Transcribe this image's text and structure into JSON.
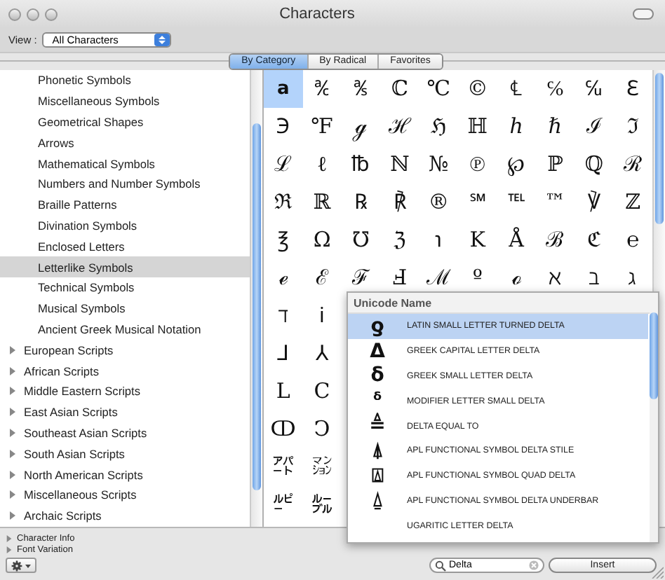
{
  "window": {
    "title": "Characters"
  },
  "toolbar": {
    "view_label": "View :",
    "view_value": "All Characters"
  },
  "tabs": [
    {
      "label": "By Category",
      "selected": true
    },
    {
      "label": "By Radical",
      "selected": false
    },
    {
      "label": "Favorites",
      "selected": false
    }
  ],
  "sidebar": {
    "items": [
      {
        "label": "Phonetic Symbols",
        "kind": "leaf",
        "selected": false
      },
      {
        "label": "Miscellaneous Symbols",
        "kind": "leaf",
        "selected": false
      },
      {
        "label": "Geometrical Shapes",
        "kind": "leaf",
        "selected": false
      },
      {
        "label": "Arrows",
        "kind": "leaf",
        "selected": false
      },
      {
        "label": "Mathematical Symbols",
        "kind": "leaf",
        "selected": false
      },
      {
        "label": "Numbers and Number Symbols",
        "kind": "leaf",
        "selected": false
      },
      {
        "label": "Braille Patterns",
        "kind": "leaf",
        "selected": false
      },
      {
        "label": "Divination Symbols",
        "kind": "leaf",
        "selected": false
      },
      {
        "label": "Enclosed Letters",
        "kind": "leaf",
        "selected": false
      },
      {
        "label": "Letterlike Symbols",
        "kind": "leaf",
        "selected": true
      },
      {
        "label": "Technical Symbols",
        "kind": "leaf",
        "selected": false
      },
      {
        "label": "Musical Symbols",
        "kind": "leaf",
        "selected": false
      },
      {
        "label": "Ancient Greek Musical Notation",
        "kind": "leaf",
        "selected": false
      },
      {
        "label": "European Scripts",
        "kind": "group",
        "expanded": false,
        "selected": false
      },
      {
        "label": "African Scripts",
        "kind": "group",
        "expanded": false,
        "selected": false
      },
      {
        "label": "Middle Eastern Scripts",
        "kind": "group",
        "expanded": false,
        "selected": false
      },
      {
        "label": "East Asian Scripts",
        "kind": "group",
        "expanded": false,
        "selected": false
      },
      {
        "label": "Southeast Asian Scripts",
        "kind": "group",
        "expanded": false,
        "selected": false
      },
      {
        "label": "South Asian Scripts",
        "kind": "group",
        "expanded": false,
        "selected": false
      },
      {
        "label": "North American Scripts",
        "kind": "group",
        "expanded": false,
        "selected": false
      },
      {
        "label": "Miscellaneous Scripts",
        "kind": "group",
        "expanded": false,
        "selected": false
      },
      {
        "label": "Archaic Scripts",
        "kind": "group",
        "expanded": false,
        "selected": false
      }
    ]
  },
  "character_grid": {
    "rows": [
      [
        {
          "char": "a",
          "selected": true
        },
        {
          "char": "℀",
          "selected": false
        },
        {
          "char": "℁",
          "selected": false
        },
        {
          "char": "ℂ",
          "selected": false
        },
        {
          "char": "℃",
          "selected": false
        },
        {
          "char": "©",
          "selected": false
        },
        {
          "char": "℄",
          "selected": false
        },
        {
          "char": "℅",
          "selected": false
        },
        {
          "char": "℆",
          "selected": false
        },
        {
          "char": "ℇ",
          "selected": false
        }
      ],
      [
        {
          "char": "℈",
          "selected": false
        },
        {
          "char": "℉",
          "selected": false
        },
        {
          "char": "ℊ",
          "selected": false
        },
        {
          "char": "ℋ",
          "selected": false
        },
        {
          "char": "ℌ",
          "selected": false
        },
        {
          "char": "ℍ",
          "selected": false
        },
        {
          "char": "ℎ",
          "selected": false
        },
        {
          "char": "ℏ",
          "selected": false
        },
        {
          "char": "ℐ",
          "selected": false
        },
        {
          "char": "ℑ",
          "selected": false
        }
      ],
      [
        {
          "char": "ℒ",
          "selected": false
        },
        {
          "char": "ℓ",
          "selected": false
        },
        {
          "char": "℔",
          "selected": false
        },
        {
          "char": "ℕ",
          "selected": false
        },
        {
          "char": "№",
          "selected": false
        },
        {
          "char": "℗",
          "selected": false
        },
        {
          "char": "℘",
          "selected": false
        },
        {
          "char": "ℙ",
          "selected": false
        },
        {
          "char": "ℚ",
          "selected": false
        },
        {
          "char": "ℛ",
          "selected": false
        }
      ],
      [
        {
          "char": "ℜ",
          "selected": false
        },
        {
          "char": "ℝ",
          "selected": false
        },
        {
          "char": "℞",
          "selected": false
        },
        {
          "char": "℟",
          "selected": false
        },
        {
          "char": "®",
          "selected": false
        },
        {
          "char": "℠",
          "selected": false
        },
        {
          "char": "℡",
          "selected": false
        },
        {
          "char": "™",
          "selected": false
        },
        {
          "char": "℣",
          "selected": false
        },
        {
          "char": "ℤ",
          "selected": false
        }
      ],
      [
        {
          "char": "℥",
          "selected": false
        },
        {
          "char": "Ω",
          "selected": false
        },
        {
          "char": "℧",
          "selected": false
        },
        {
          "char": "ℨ",
          "selected": false
        },
        {
          "char": "℩",
          "selected": false
        },
        {
          "char": "K",
          "selected": false
        },
        {
          "char": "Å",
          "selected": false
        },
        {
          "char": "ℬ",
          "selected": false
        },
        {
          "char": "ℭ",
          "selected": false
        },
        {
          "char": "℮",
          "selected": false
        }
      ],
      [
        {
          "char": "ℯ",
          "selected": false
        },
        {
          "char": "ℰ",
          "selected": false
        },
        {
          "char": "ℱ",
          "selected": false
        },
        {
          "char": "Ⅎ",
          "selected": false
        },
        {
          "char": "ℳ",
          "selected": false
        },
        {
          "char": "º",
          "selected": false
        },
        {
          "char": "ℴ",
          "selected": false
        },
        {
          "char": "ℵ",
          "selected": false
        },
        {
          "char": "ℶ",
          "selected": false
        },
        {
          "char": "ℷ",
          "selected": false
        }
      ],
      [
        {
          "char": "ℸ",
          "selected": false
        },
        {
          "char": "ℹ",
          "selected": false
        }
      ],
      [
        {
          "char": "⅃",
          "selected": false
        },
        {
          "char": "⅄",
          "selected": false
        }
      ],
      [
        {
          "char": "L",
          "selected": false
        },
        {
          "char": "Ⅽ",
          "selected": false
        }
      ],
      [
        {
          "char": "ↀ",
          "selected": false
        },
        {
          "char": "Ↄ",
          "selected": false
        }
      ],
      [
        {
          "char": "㌀",
          "selected": false
        },
        {
          "char": "㍇",
          "selected": false
        }
      ],
      [
        {
          "char": "㍓",
          "selected": false
        },
        {
          "char": "㍔",
          "selected": false
        }
      ]
    ]
  },
  "search_results": {
    "header": "Unicode Name",
    "results": [
      {
        "char": "ƍ",
        "name": "LATIN SMALL LETTER TURNED DELTA",
        "selected": true
      },
      {
        "char": "Δ",
        "name": "GREEK CAPITAL LETTER DELTA",
        "selected": false
      },
      {
        "char": "δ",
        "name": "GREEK SMALL LETTER DELTA",
        "selected": false
      },
      {
        "char": "ᵟ",
        "name": "MODIFIER LETTER SMALL DELTA",
        "selected": false
      },
      {
        "char": "≜",
        "name": "DELTA EQUAL TO",
        "selected": false
      },
      {
        "char": "⍋",
        "name": "APL FUNCTIONAL SYMBOL DELTA STILE",
        "selected": false
      },
      {
        "char": "⍍",
        "name": "APL FUNCTIONAL SYMBOL QUAD DELTA",
        "selected": false
      },
      {
        "char": "⍙",
        "name": "APL FUNCTIONAL SYMBOL DELTA UNDERBAR",
        "selected": false
      },
      {
        "name": "UGARITIC LETTER DELTA",
        "selected": false
      }
    ]
  },
  "bottom": {
    "disclosures": [
      {
        "label": "Character Info",
        "expanded": false
      },
      {
        "label": "Font Variation",
        "expanded": false
      }
    ],
    "search": {
      "value": "Delta"
    },
    "insert_button": "Insert"
  }
}
